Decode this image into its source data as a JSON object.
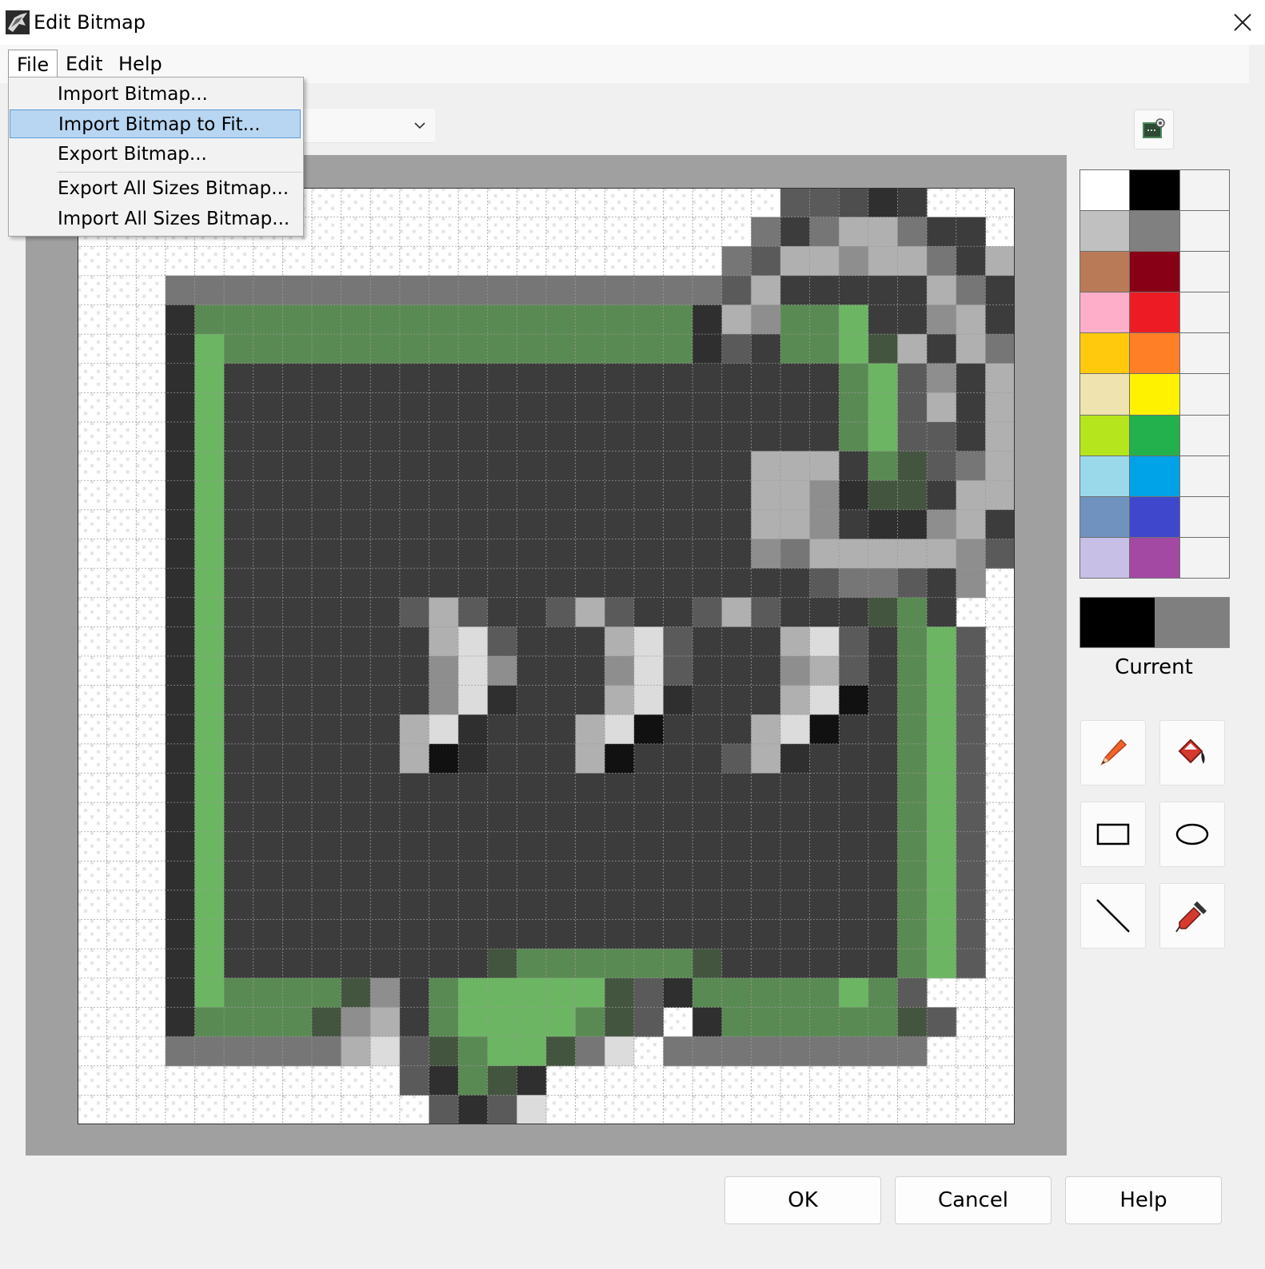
{
  "window": {
    "title": "Edit Bitmap",
    "app_icon": "rhino-icon",
    "close_icon": "close-icon"
  },
  "menubar": {
    "items": [
      {
        "label": "File",
        "open": true
      },
      {
        "label": "Edit"
      },
      {
        "label": "Help"
      }
    ]
  },
  "file_menu": {
    "items": [
      {
        "label": "Import Bitmap..."
      },
      {
        "label": "Import Bitmap to Fit...",
        "highlighted": true
      },
      {
        "label": "Export Bitmap..."
      },
      {
        "label": "Export All Sizes Bitmap..."
      },
      {
        "label": "Import All Sizes Bitmap..."
      }
    ]
  },
  "size_combo": {
    "value": "",
    "icon": "chevron-down-icon"
  },
  "preview_button": {
    "icon": "preview-icon"
  },
  "bitmap": {
    "width": 32,
    "height": 32,
    "legend": {
      ".": "transparent",
      "K": "#3c3c3c",
      "D": "#2f2f2f",
      "G": "#767676",
      "M": "#8e8e8e",
      "N": "#5a5a5a",
      "L": "#b0b0b0",
      "W": "#dcdcdc",
      "B": "#111111",
      "g": "#5a8a53",
      "l": "#6cb663",
      "d": "#44553f",
      "O": "#4e4e4e"
    },
    "rows": [
      "........................NNODK...",
      ".......................GKGLLGKK.",
      "......................GNLLMLLGKL",
      "...GGGGGGGGGGGGGGGGGGGNLKKKKKLGK",
      "...DgggggggggggggggggDLMgglKKMLKG",
      "...DlggggggggggggggggDNKggldLKLG",
      "...DlKKKKKKKKKKKKKKKKKKKKKglNMKLG",
      "...DlKKKKKKKKKKKKKKKKKKKKKglNLKLG",
      "...DlKKKKKKKKKKKKKKKKKKKKKglNNKLN",
      "...DlKKKKKKKKKKKKKKKKKKLLLKgdNGLM",
      "...DlKKKKKKKKKKKKKKKKKKLLMDddKLLK",
      "...DlKKKKKKKKKKKKKKKKKKLLMKDDMLK",
      "...DlKKKKKKKKKKKKKKKKKKMGLLLLLMNK",
      "...DlKKKKKKKKKKKKKKKKKKKKNGGNKM.",
      "...DlKKKKKKNLNKKNLNKKNLNKKKdgK..",
      "...DlKKKKKKKLWNKKKLWNKKKLWNKglN..",
      "...DlKKKKKKKMWMKKKMWNKKKMLNKglN..",
      "...DlKKKKKKKMWDKKKLWDKKKLWBKglN..",
      "...DlKKKKKKLWDKKKLWBKKKLWBKKglN..",
      "...DlKKKKKKLBDKKKLBKKKNLDKKKglN..",
      "...DlKKKKKKKKKKKKKKKKKKKKKKKglN..",
      "...DlKKKKKKKKKKKKKKKKKKKKKKKglN..",
      "...DlKKKKKKKKKKKKKKKKKKKKKKKglN..",
      "...DlKKKKKKKKKKKKKKKKKKKKKKKglN..",
      "...DlKKKKKKKKKKKKKKKKKKKKKKKglN..",
      "...DlKKKKKKKKKKKKKKKKKKKKKKKglN..",
      "...DlKKKKKKKKKdggggggdKKKKKKglN..",
      "...DlggggdMKgllllldNDggggglgN..",
      "...DggggdMLKgllllgdN.DggggggdN..",
      "...GGGGGGLWNdglldGW.GGGGGGGGG...",
      "...........NDgdD................",
      "............NDNW................"
    ]
  },
  "palette": {
    "colors": [
      "#ffffff",
      "#000000",
      "",
      "#c0c0c0",
      "#808080",
      "",
      "#b97a57",
      "#880015",
      "",
      "#ffaec9",
      "#ed1c24",
      "",
      "#ffc90e",
      "#ff7f27",
      "",
      "#efe4b0",
      "#fff200",
      "",
      "#b5e61d",
      "#22b14c",
      "",
      "#99d9ea",
      "#00a2e8",
      "",
      "#7092be",
      "#3f48cc",
      "",
      "#c8bfe7",
      "#a349a4",
      ""
    ]
  },
  "current_colors": {
    "label": "Current",
    "primary": "#000000",
    "secondary": "#7f7f7f"
  },
  "tools": [
    {
      "name": "pencil-tool",
      "icon": "pencil-icon"
    },
    {
      "name": "fill-tool",
      "icon": "paint-bucket-icon"
    },
    {
      "name": "rectangle-tool",
      "icon": "rectangle-icon"
    },
    {
      "name": "ellipse-tool",
      "icon": "ellipse-icon"
    },
    {
      "name": "line-tool",
      "icon": "line-icon"
    },
    {
      "name": "eyedropper-tool",
      "icon": "eyedropper-icon"
    }
  ],
  "buttons": {
    "ok": "OK",
    "cancel": "Cancel",
    "help": "Help"
  }
}
